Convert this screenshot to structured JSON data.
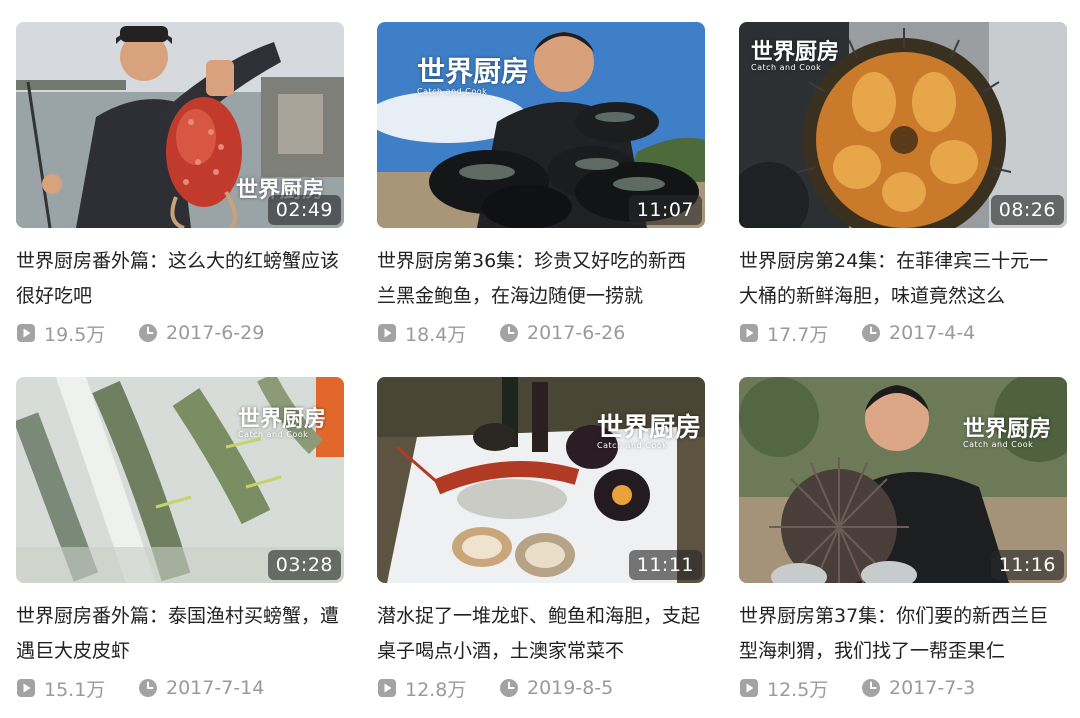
{
  "watermark": {
    "brand": "世界厨房",
    "sub": "Catch and Cook"
  },
  "colors": {
    "meta_text": "#9a9a9a",
    "icon": "#a3a3a3",
    "title_text": "#222222"
  },
  "videos": [
    {
      "title": "世界厨房番外篇：这么大的红螃蟹应该很好吃吧",
      "duration": "02:49",
      "views": "19.5万",
      "date": "2017-6-29"
    },
    {
      "title": "世界厨房第36集：珍贵又好吃的新西兰黑金鲍鱼，在海边随便一捞就",
      "duration": "11:07",
      "views": "18.4万",
      "date": "2017-6-26"
    },
    {
      "title": "世界厨房第24集：在菲律宾三十元一大桶的新鲜海胆，味道竟然这么",
      "duration": "08:26",
      "views": "17.7万",
      "date": "2017-4-4"
    },
    {
      "title": "世界厨房番外篇：泰国渔村买螃蟹，遭遇巨大皮皮虾",
      "duration": "03:28",
      "views": "15.1万",
      "date": "2017-7-14"
    },
    {
      "title": "潜水捉了一堆龙虾、鲍鱼和海胆，支起桌子喝点小酒，土澳家常菜不",
      "duration": "11:11",
      "views": "12.8万",
      "date": "2019-8-5"
    },
    {
      "title": "世界厨房第37集：你们要的新西兰巨型海刺猬，我们找了一帮歪果仁",
      "duration": "11:16",
      "views": "12.5万",
      "date": "2017-7-3"
    }
  ]
}
